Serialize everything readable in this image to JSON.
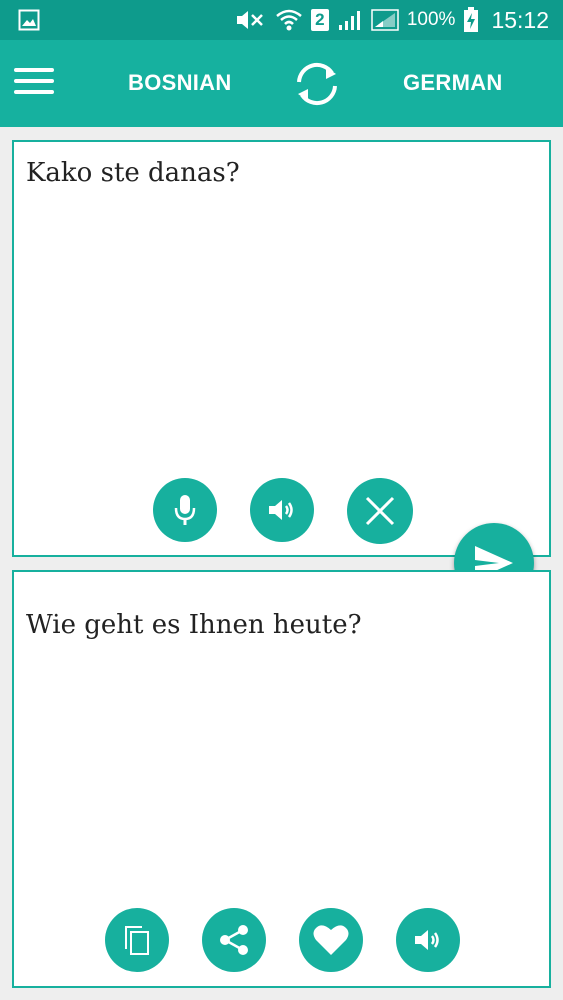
{
  "status_bar": {
    "battery": "100%",
    "time": "15:12",
    "sim": "2",
    "icons": [
      "image-icon",
      "mute-icon",
      "wifi-icon",
      "sim-icon",
      "signal-icon",
      "signal-icon",
      "battery-charging-icon"
    ]
  },
  "app_bar": {
    "source_language": "BOSNIAN",
    "target_language": "GERMAN",
    "icons": [
      "menu-icon",
      "swap-icon"
    ]
  },
  "source_panel": {
    "text": "Kako ste danas?",
    "buttons": [
      "microphone-icon",
      "speaker-icon",
      "close-icon"
    ]
  },
  "target_panel": {
    "text": "Wie geht es Ihnen heute?",
    "buttons": [
      "copy-icon",
      "share-icon",
      "heart-icon",
      "speaker-icon"
    ]
  },
  "send_button": {
    "icon": "send-icon"
  },
  "colors": {
    "status_bar": "#0e9b8c",
    "accent": "#16b19f",
    "background": "#eeeeee"
  }
}
